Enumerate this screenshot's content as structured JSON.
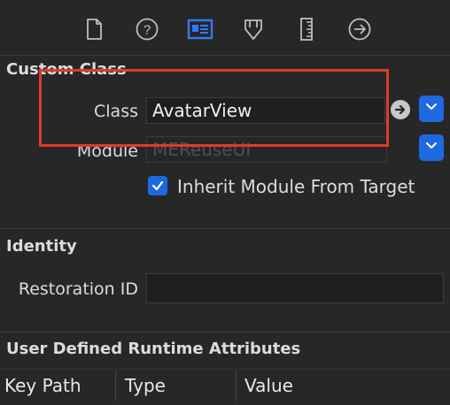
{
  "toolbar": {
    "icons": [
      "file-icon",
      "help-icon",
      "identity-inspector-icon",
      "attributes-icon",
      "size-ruler-icon",
      "connections-icon"
    ],
    "active_icon": "identity-inspector-icon",
    "accent": "#1f69e0"
  },
  "custom_class": {
    "title": "Custom Class",
    "class_label": "Class",
    "class_value": "AvatarView",
    "module_label": "Module",
    "module_value": "MEReuseUI",
    "inherit_checked": true,
    "inherit_label": "Inherit Module From Target"
  },
  "identity": {
    "title": "Identity",
    "restoration_label": "Restoration ID",
    "restoration_value": ""
  },
  "runtime_attributes": {
    "title": "User Defined Runtime Attributes",
    "columns": [
      "Key Path",
      "Type",
      "Value"
    ]
  },
  "annotation": {
    "color": "#e03a2a"
  }
}
